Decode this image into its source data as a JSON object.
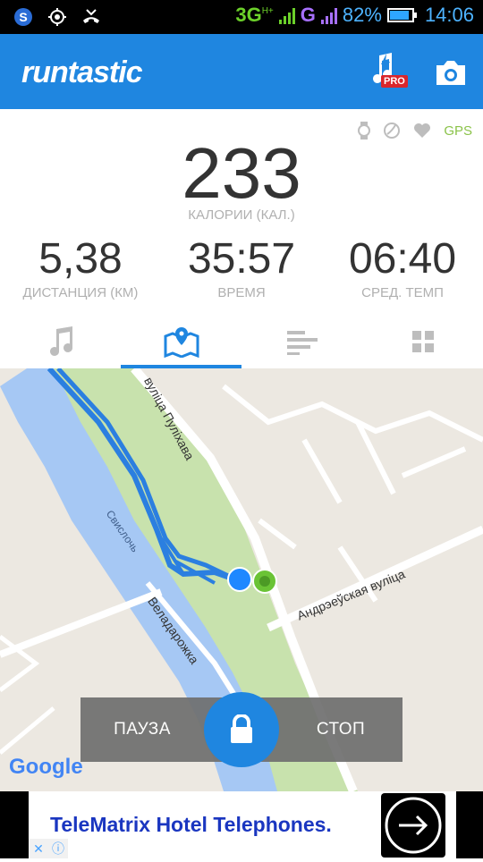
{
  "status_bar": {
    "network_3g": "3G",
    "network_hplus": "H+",
    "network_g": "G",
    "battery": "82%",
    "battery_level": 0.82,
    "time": "14:06"
  },
  "app_bar": {
    "logo": "runtastic",
    "pro_badge": "PRO",
    "icons": [
      "music-pro-icon",
      "camera-icon"
    ]
  },
  "sensors": {
    "icons": [
      "watch-icon",
      "cadence-icon",
      "heart-icon"
    ],
    "gps": "GPS"
  },
  "calories": {
    "value": "233",
    "label": "КАЛОРИИ (КАЛ.)"
  },
  "metrics": [
    {
      "value": "5,38",
      "label": "ДИСТАНЦИЯ (КМ)"
    },
    {
      "value": "35:57",
      "label": "ВРЕМЯ"
    },
    {
      "value": "06:40",
      "label": "СРЕД. ТЕМП"
    }
  ],
  "tabs": [
    {
      "icon": "music-note-icon",
      "active": false
    },
    {
      "icon": "map-pin-icon",
      "active": true
    },
    {
      "icon": "bar-list-icon",
      "active": false
    },
    {
      "icon": "grid-icon",
      "active": false
    }
  ],
  "map": {
    "labels": {
      "street_pulikhava": "вуліца Пуліхава",
      "river": "Свислочь",
      "street_veladarozhka": "Веладарожка",
      "street_andrzeuskaya": "Андрэеўская вуліца"
    },
    "attribution": "Google"
  },
  "controls": {
    "pause": "ПАУЗА",
    "stop": "СТОП",
    "lock_icon": "lock-icon"
  },
  "ad": {
    "title": "TeleMatrix Hotel Telephones.",
    "close_icon": "close-icon",
    "info_icon": "info-icon"
  },
  "colors": {
    "primary": "#1f86e0",
    "route": "#2b7fe0",
    "start_marker": "#1e88ff",
    "end_marker": "#6ac335",
    "park": "#c9e3b0",
    "river": "#a6c8f4"
  }
}
